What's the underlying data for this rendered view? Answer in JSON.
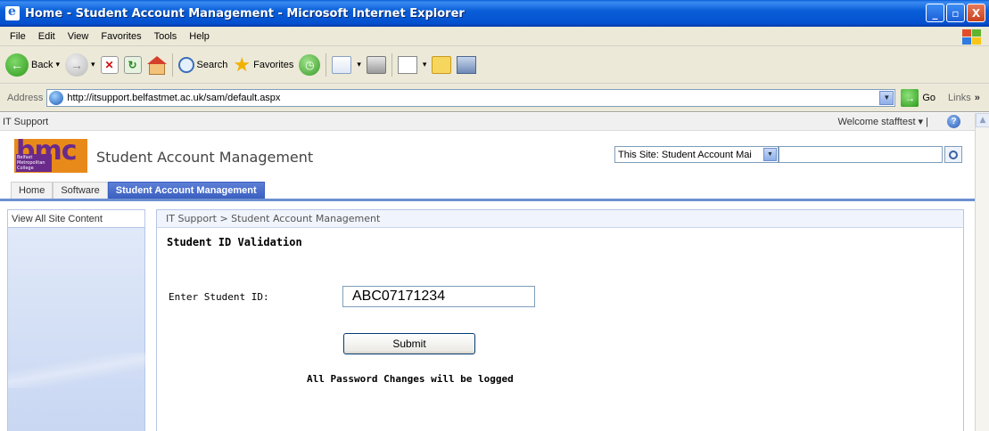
{
  "window": {
    "title": "Home - Student Account Management - Microsoft Internet Explorer",
    "minimize": "_",
    "maximize": "▫",
    "close": "X"
  },
  "menu": [
    "File",
    "Edit",
    "View",
    "Favorites",
    "Tools",
    "Help"
  ],
  "toolbar": {
    "back": "Back",
    "search": "Search",
    "favorites": "Favorites"
  },
  "address": {
    "label": "Address",
    "url": "http://itsupport.belfastmet.ac.uk/sam/default.aspx",
    "go": "Go",
    "links": "Links"
  },
  "sharepoint": {
    "site_link": "IT Support",
    "welcome": "Welcome stafftest ▾ |",
    "logo_text": "bmc",
    "logo_sub": "Belfast Metropolitan College",
    "site_title": "Student Account Management",
    "search_scope": "This Site: Student Account Mai",
    "nav_tabs": [
      {
        "label": "Home",
        "active": false
      },
      {
        "label": "Software",
        "active": false
      },
      {
        "label": "Student Account Management",
        "active": true
      }
    ],
    "view_all": "View All Site Content",
    "breadcrumb": "IT Support > Student Account Management"
  },
  "form": {
    "heading": "Student ID Validation",
    "label": "Enter Student ID:",
    "student_id": "ABC07171234",
    "submit": "Submit",
    "notice": "All Password Changes will be logged"
  },
  "colors": {
    "titlebar": "#0a5fd8",
    "active_tab": "#3a5fc0",
    "leftnav": "#d7e2f6",
    "logo_orange": "#e88a1a",
    "logo_purple": "#6a2a8a"
  }
}
